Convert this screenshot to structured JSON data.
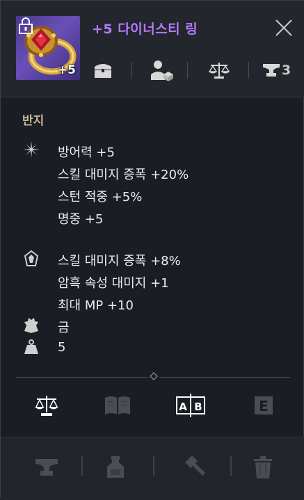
{
  "item": {
    "name": "+5 다이너스티 링",
    "enhancement": "+5",
    "category": "반지",
    "icon": "gold-ruby-ring-icon"
  },
  "header": {
    "icons": [
      "chest-icon",
      "npc-shop-icon",
      "scale-icon",
      "anvil-icon"
    ],
    "anvil_count": "3"
  },
  "stats": {
    "base_lines": [
      "방어력 +5",
      "스킬 대미지 증폭 +20%",
      "스턴 적중 +5%",
      "명중 +5"
    ],
    "extra_lines": [
      "스킬 대미지 증폭 +8%",
      "암흑 속성 대미지 +1",
      "최대 MP +10"
    ],
    "material": "금",
    "weight": "5"
  },
  "actions": [
    "scale-icon",
    "book-icon",
    "compare-ab-icon",
    "e-icon"
  ],
  "footer": [
    "anvil-icon",
    "potion-icon",
    "hammer-icon",
    "trash-icon"
  ],
  "colors": {
    "item_name": "#b779ff",
    "category": "#c7b596",
    "text": "#ececec"
  }
}
